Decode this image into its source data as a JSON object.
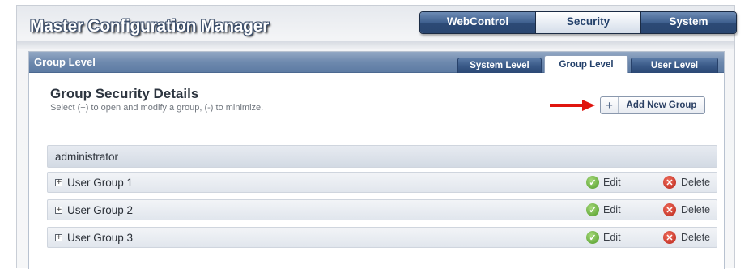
{
  "app": {
    "title": "Master Configuration Manager"
  },
  "top_nav": [
    {
      "label": "WebControl",
      "active": false
    },
    {
      "label": "Security",
      "active": true
    },
    {
      "label": "System",
      "active": false
    }
  ],
  "panel": {
    "title": "Group Level",
    "tabs": [
      {
        "label": "System Level",
        "active": false
      },
      {
        "label": "Group Level",
        "active": true
      },
      {
        "label": "User Level",
        "active": false
      }
    ]
  },
  "details": {
    "title": "Group Security Details",
    "subtitle": "Select (+) to open and modify a group, (-) to minimize.",
    "add_button_icon": "+",
    "add_button_label": "Add New Group"
  },
  "groups": {
    "admin_label": "administrator",
    "expander_icon": "+",
    "rows": [
      {
        "label": "User Group 1"
      },
      {
        "label": "User Group 2"
      },
      {
        "label": "User Group 3"
      }
    ],
    "edit_label": "Edit",
    "delete_label": "Delete",
    "edit_icon": "✓",
    "delete_icon": "✕"
  },
  "colors": {
    "nav_blue": "#2c4a76",
    "panel_header": "#6e89ae",
    "annotation_arrow": "#e0150f",
    "edit_green": "#4f9a27",
    "delete_red": "#b8261a"
  }
}
